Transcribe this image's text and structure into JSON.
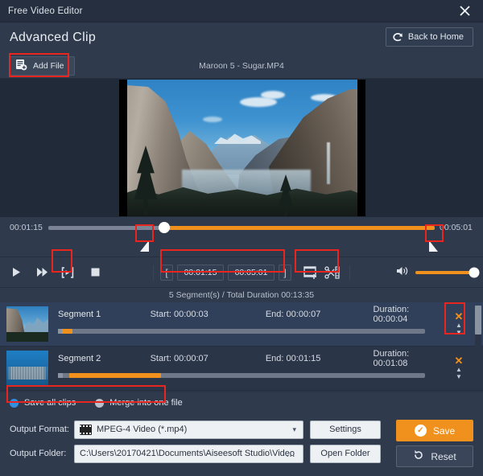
{
  "window": {
    "title": "Free Video Editor",
    "close_icon": "close-icon"
  },
  "header": {
    "title": "Advanced Clip",
    "back_button": {
      "label": "Back to Home",
      "icon": "redo-arrow-icon"
    }
  },
  "file_bar": {
    "add_file_button": {
      "label": "Add File",
      "icon": "add-file-icon"
    },
    "file_name": "Maroon 5 - Sugar.MP4"
  },
  "scrub": {
    "start_time": "00:01:15",
    "end_time": "00:05:01",
    "playhead_percent": 30,
    "filled_percent": 70,
    "left_handle_percent": 30,
    "right_handle_percent": 90
  },
  "transport": {
    "play_icon": "play-icon",
    "fast_forward_icon": "fast-forward-icon",
    "set_clip_icon": "set-clip-bracket-icon",
    "stop_icon": "stop-icon",
    "start_bracket": "[",
    "end_bracket": "]",
    "clip_start": "00:01:15",
    "clip_end": "00:05:01",
    "add_clip_icon": "add-clip-icon",
    "split_clip_icon": "scissors-split-icon",
    "volume_icon": "volume-icon",
    "volume_percent": 100
  },
  "summary": {
    "text": "5 Segment(s) / Total Duration 00:13:35"
  },
  "segments": {
    "labels": {
      "start": "Start:",
      "end": "End:",
      "duration": "Duration:"
    },
    "rows": [
      {
        "name": "Segment 1",
        "start": "00:00:03",
        "end": "00:00:07",
        "duration": "00:00:04",
        "progress_start_percent": 1,
        "progress_width_percent": 3,
        "selected": true,
        "delete_icon": "delete-x-icon",
        "move_up_icon": "move-up-icon",
        "move_down_icon": "move-down-icon"
      },
      {
        "name": "Segment 2",
        "start": "00:00:07",
        "end": "00:01:15",
        "duration": "00:01:08",
        "progress_start_percent": 3,
        "progress_width_percent": 25,
        "selected": false,
        "delete_icon": "delete-x-icon",
        "move_up_icon": "move-up-icon",
        "move_down_icon": "move-down-icon"
      }
    ]
  },
  "save_mode": {
    "options": [
      {
        "label": "Save all clips",
        "selected": true
      },
      {
        "label": "Merge into one file",
        "selected": false
      }
    ]
  },
  "output": {
    "format_label": "Output Format:",
    "format_value": "MPEG-4 Video (*.mp4)",
    "format_icon": "film-format-icon",
    "caret_icon": "chevron-down-icon",
    "settings_button": "Settings",
    "folder_label": "Output Folder:",
    "folder_value": "C:\\Users\\20170421\\Documents\\Aiseesoft Studio\\Video",
    "browse_icon": "ellipsis-icon",
    "open_folder_button": "Open Folder",
    "save_button": {
      "label": "Save",
      "icon": "check-circle-icon"
    },
    "reset_button": {
      "label": "Reset",
      "icon": "reset-arrow-icon"
    }
  },
  "colors": {
    "accent_orange": "#f0911e",
    "highlight_red": "#e8251f",
    "radio_blue": "#2f8fe0",
    "background": "#2f3a4d",
    "titlebar": "#252f40"
  }
}
